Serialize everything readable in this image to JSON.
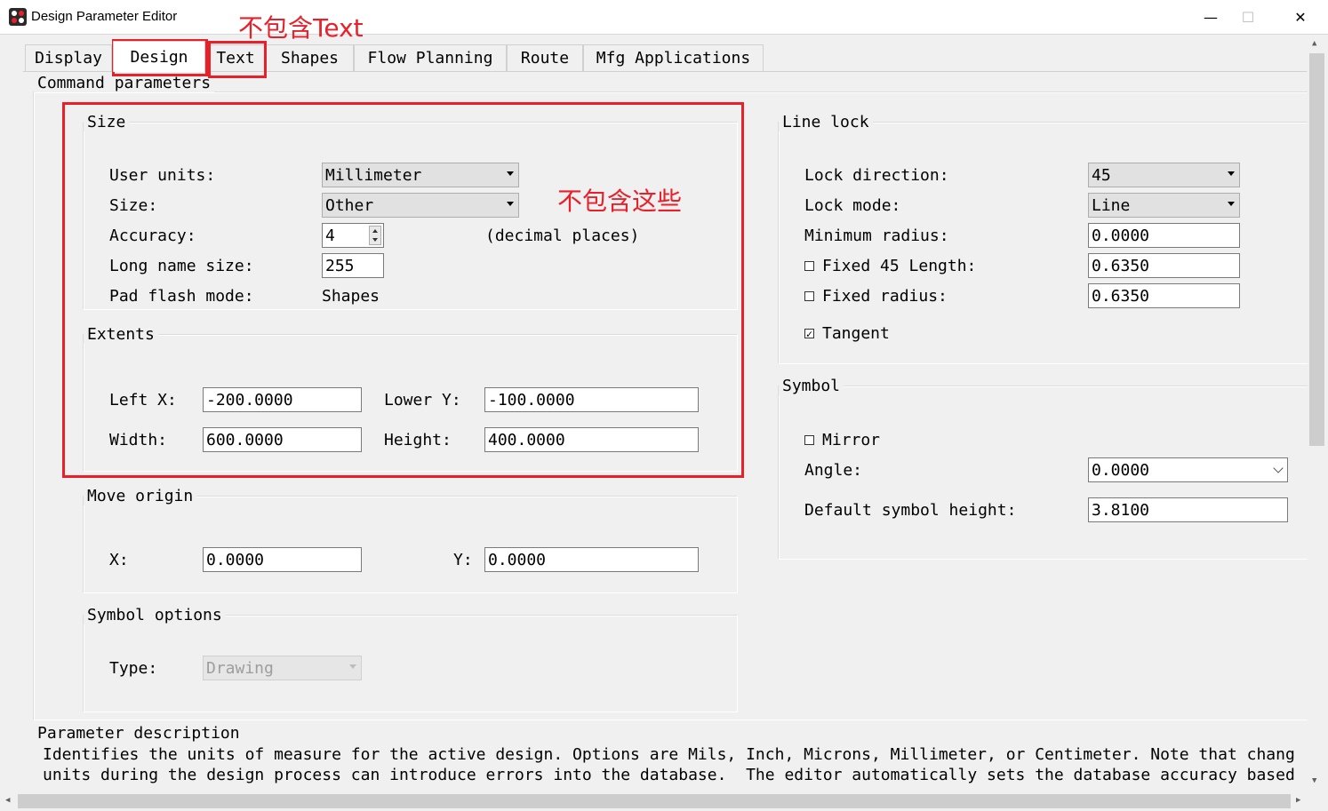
{
  "window": {
    "title": "Design Parameter Editor",
    "minimize": "—",
    "maximize": "☐",
    "close": "✕"
  },
  "tabs": [
    "Display",
    "Design",
    "Text",
    "Shapes",
    "Flow Planning",
    "Route",
    "Mfg Applications"
  ],
  "active_tab": "Design",
  "annotations": {
    "text_note": "不包含Text",
    "size_note": "不包含这些",
    "color": "#e8202a"
  },
  "command_parameters": {
    "label": "Command parameters",
    "size": {
      "legend": "Size",
      "user_units_label": "User units:",
      "user_units_value": "Millimeter",
      "size_label": "Size:",
      "size_value": "Other",
      "accuracy_label": "Accuracy:",
      "accuracy_value": "4",
      "accuracy_suffix": "(decimal places)",
      "long_name_label": "Long name size:",
      "long_name_value": "255",
      "pad_flash_label": "Pad flash mode:",
      "pad_flash_value": "Shapes"
    },
    "extents": {
      "legend": "Extents",
      "left_x_label": "Left X:",
      "left_x_value": "-200.0000",
      "lower_y_label": "Lower Y:",
      "lower_y_value": "-100.0000",
      "width_label": "Width:",
      "width_value": "600.0000",
      "height_label": "Height:",
      "height_value": "400.0000"
    },
    "move_origin": {
      "legend": "Move origin",
      "x_label": "X:",
      "x_value": "0.0000",
      "y_label": "Y:",
      "y_value": "0.0000"
    },
    "symbol_options": {
      "legend": "Symbol options",
      "type_label": "Type:",
      "type_value": "Drawing"
    },
    "line_lock": {
      "legend": "Line lock",
      "lock_direction_label": "Lock direction:",
      "lock_direction_value": "45",
      "lock_mode_label": "Lock mode:",
      "lock_mode_value": "Line",
      "min_radius_label": "Minimum radius:",
      "min_radius_value": "0.0000",
      "fixed45_label": "Fixed 45 Length:",
      "fixed45_value": "0.6350",
      "fixed45_checked": false,
      "fixed_radius_label": "Fixed radius:",
      "fixed_radius_value": "0.6350",
      "fixed_radius_checked": false,
      "tangent_label": "Tangent",
      "tangent_checked": true
    },
    "symbol": {
      "legend": "Symbol",
      "mirror_label": "Mirror",
      "mirror_checked": false,
      "angle_label": "Angle:",
      "angle_value": "0.0000",
      "default_height_label": "Default symbol height:",
      "default_height_value": "3.8100"
    }
  },
  "parameter_description": {
    "label": "Parameter description",
    "line1": "Identifies the units of measure for the active design. Options are Mils, Inch, Microns, Millimeter, or Centimeter. Note that chang",
    "line2": "units during the design process can introduce errors into the database.  The editor automatically sets the database accuracy based"
  }
}
